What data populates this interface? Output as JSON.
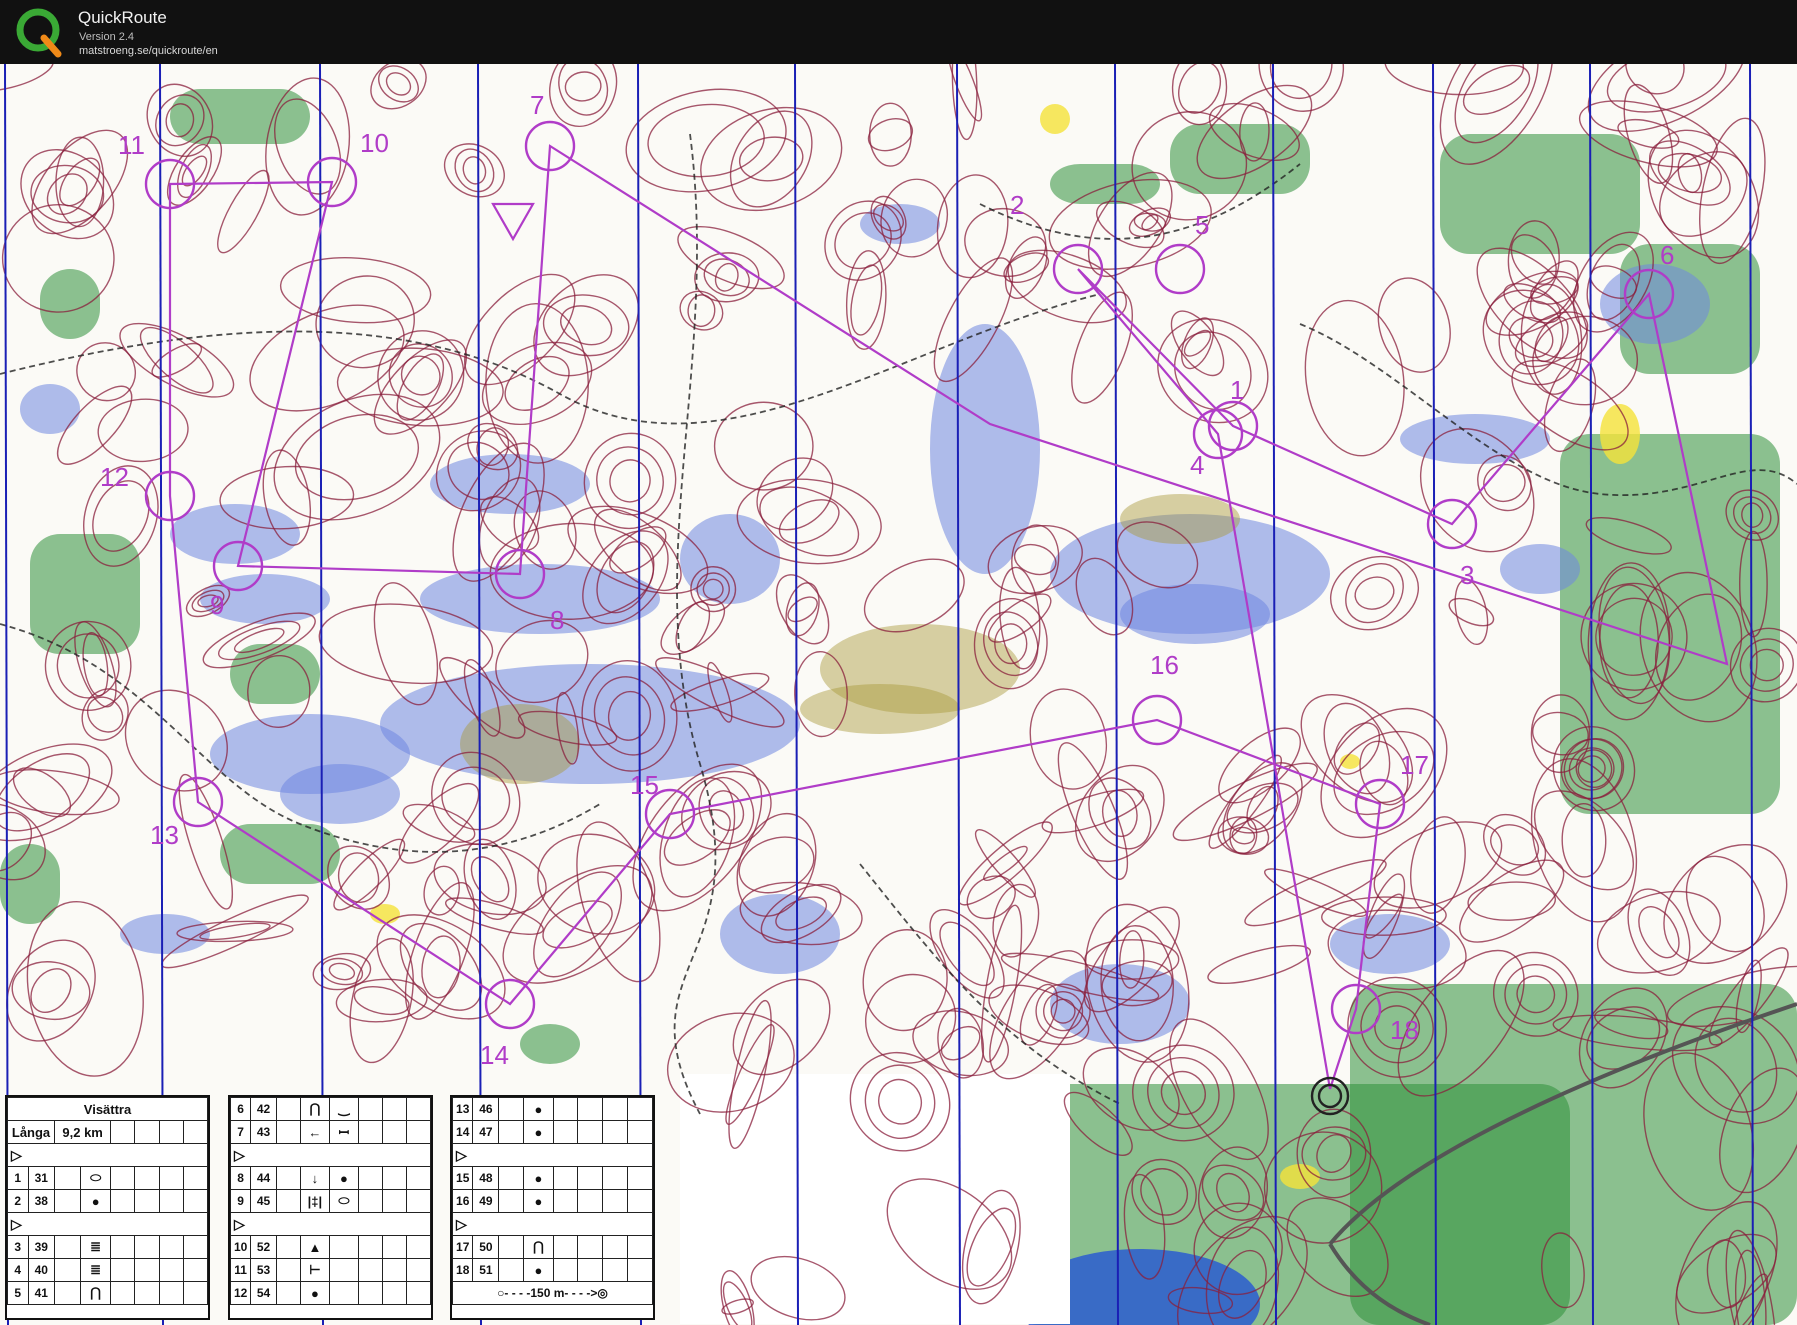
{
  "app": {
    "title": "QuickRoute",
    "version": "Version 2.4",
    "url": "matstroeng.se/quickroute/en",
    "logo_letter": "Q"
  },
  "colors": {
    "titlebar": "#111111",
    "course": "#b03cc8",
    "contour": "#8a1f3c",
    "marsh": "#6f86e0",
    "forest": "#2f8f3a",
    "meridian": "#1a1fb5",
    "open": "#f5e23a"
  },
  "map": {
    "control_numbers": [
      "1",
      "2",
      "3",
      "4",
      "5",
      "6",
      "7",
      "8",
      "9",
      "10",
      "11",
      "12",
      "13",
      "14",
      "15",
      "16",
      "17",
      "18"
    ]
  },
  "description": {
    "event": "Visättra",
    "course": "Långa",
    "length": "9,2 km",
    "rows": [
      {
        "num": "1",
        "code": "31",
        "symbol": "⬭"
      },
      {
        "num": "2",
        "code": "38",
        "symbol": "●"
      },
      {
        "num": "3",
        "code": "39",
        "symbol": "≣"
      },
      {
        "num": "4",
        "code": "40",
        "symbol": "≣"
      },
      {
        "num": "5",
        "code": "41",
        "symbol": "⋂"
      },
      {
        "num": "6",
        "code": "42",
        "symbol": "⋂"
      },
      {
        "num": "7",
        "code": "43",
        "symbol": "←"
      },
      {
        "num": "8",
        "code": "44",
        "symbol": "↓"
      },
      {
        "num": "9",
        "code": "45",
        "symbol": "|‡|"
      },
      {
        "num": "10",
        "code": "52",
        "symbol": "▲"
      },
      {
        "num": "11",
        "code": "53",
        "symbol": "⊢"
      },
      {
        "num": "12",
        "code": "54",
        "symbol": "●"
      },
      {
        "num": "13",
        "code": "46",
        "symbol": "●"
      },
      {
        "num": "14",
        "code": "47",
        "symbol": "●"
      },
      {
        "num": "15",
        "code": "48",
        "symbol": "●"
      },
      {
        "num": "16",
        "code": "49",
        "symbol": "●"
      },
      {
        "num": "17",
        "code": "50",
        "symbol": "⋂"
      },
      {
        "num": "18",
        "code": "51",
        "symbol": "●"
      }
    ],
    "extra_6": "‿",
    "extra_7": "ꟷ",
    "extra_8": "●",
    "extra_9": "⬭",
    "leg_marker": "▷",
    "finish_leg": "○- - - -150 m- - - ->◎"
  }
}
